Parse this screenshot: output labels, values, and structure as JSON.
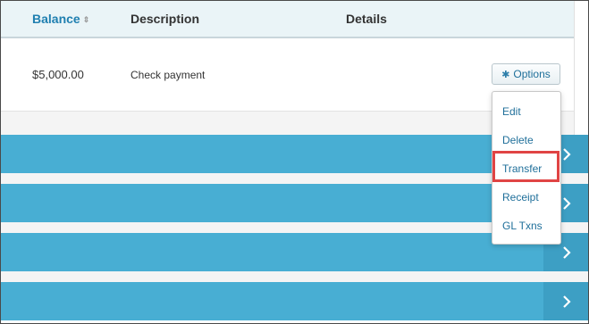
{
  "table": {
    "headers": {
      "balance": "Balance",
      "sort_indicator": "⇕",
      "description": "Description",
      "details": "Details"
    },
    "row": {
      "balance": "$5,000.00",
      "description": "Check payment"
    }
  },
  "options_button": {
    "label": "Options",
    "icon": "gear-icon"
  },
  "dropdown": {
    "items": [
      "Edit",
      "Delete",
      "Transfer",
      "Receipt",
      "GL Txns"
    ],
    "highlighted_item": "Transfer"
  },
  "colors": {
    "accent_bar": "#48aed3",
    "link": "#1f6f9a",
    "highlight_border": "#e04444"
  }
}
